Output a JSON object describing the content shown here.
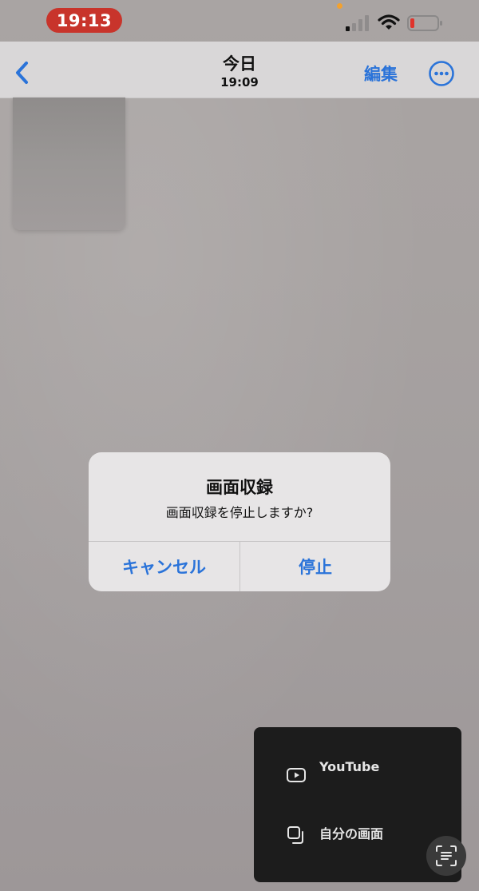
{
  "status_bar": {
    "time": "19:13"
  },
  "nav": {
    "title": "今日",
    "subtitle": "19:09",
    "edit_label": "編集"
  },
  "alert": {
    "title": "画面収録",
    "message": "画面収録を停止しますか?",
    "cancel_label": "キャンセル",
    "stop_label": "停止"
  },
  "share_panel": {
    "items": [
      {
        "label": "YouTube",
        "icon": "youtube-play-icon"
      },
      {
        "label": "自分の画面",
        "icon": "copy-screen-icon"
      }
    ]
  },
  "colors": {
    "accent": "#2a73d9",
    "recording_pill": "#c8342b",
    "panel_bg": "#1c1c1c"
  }
}
